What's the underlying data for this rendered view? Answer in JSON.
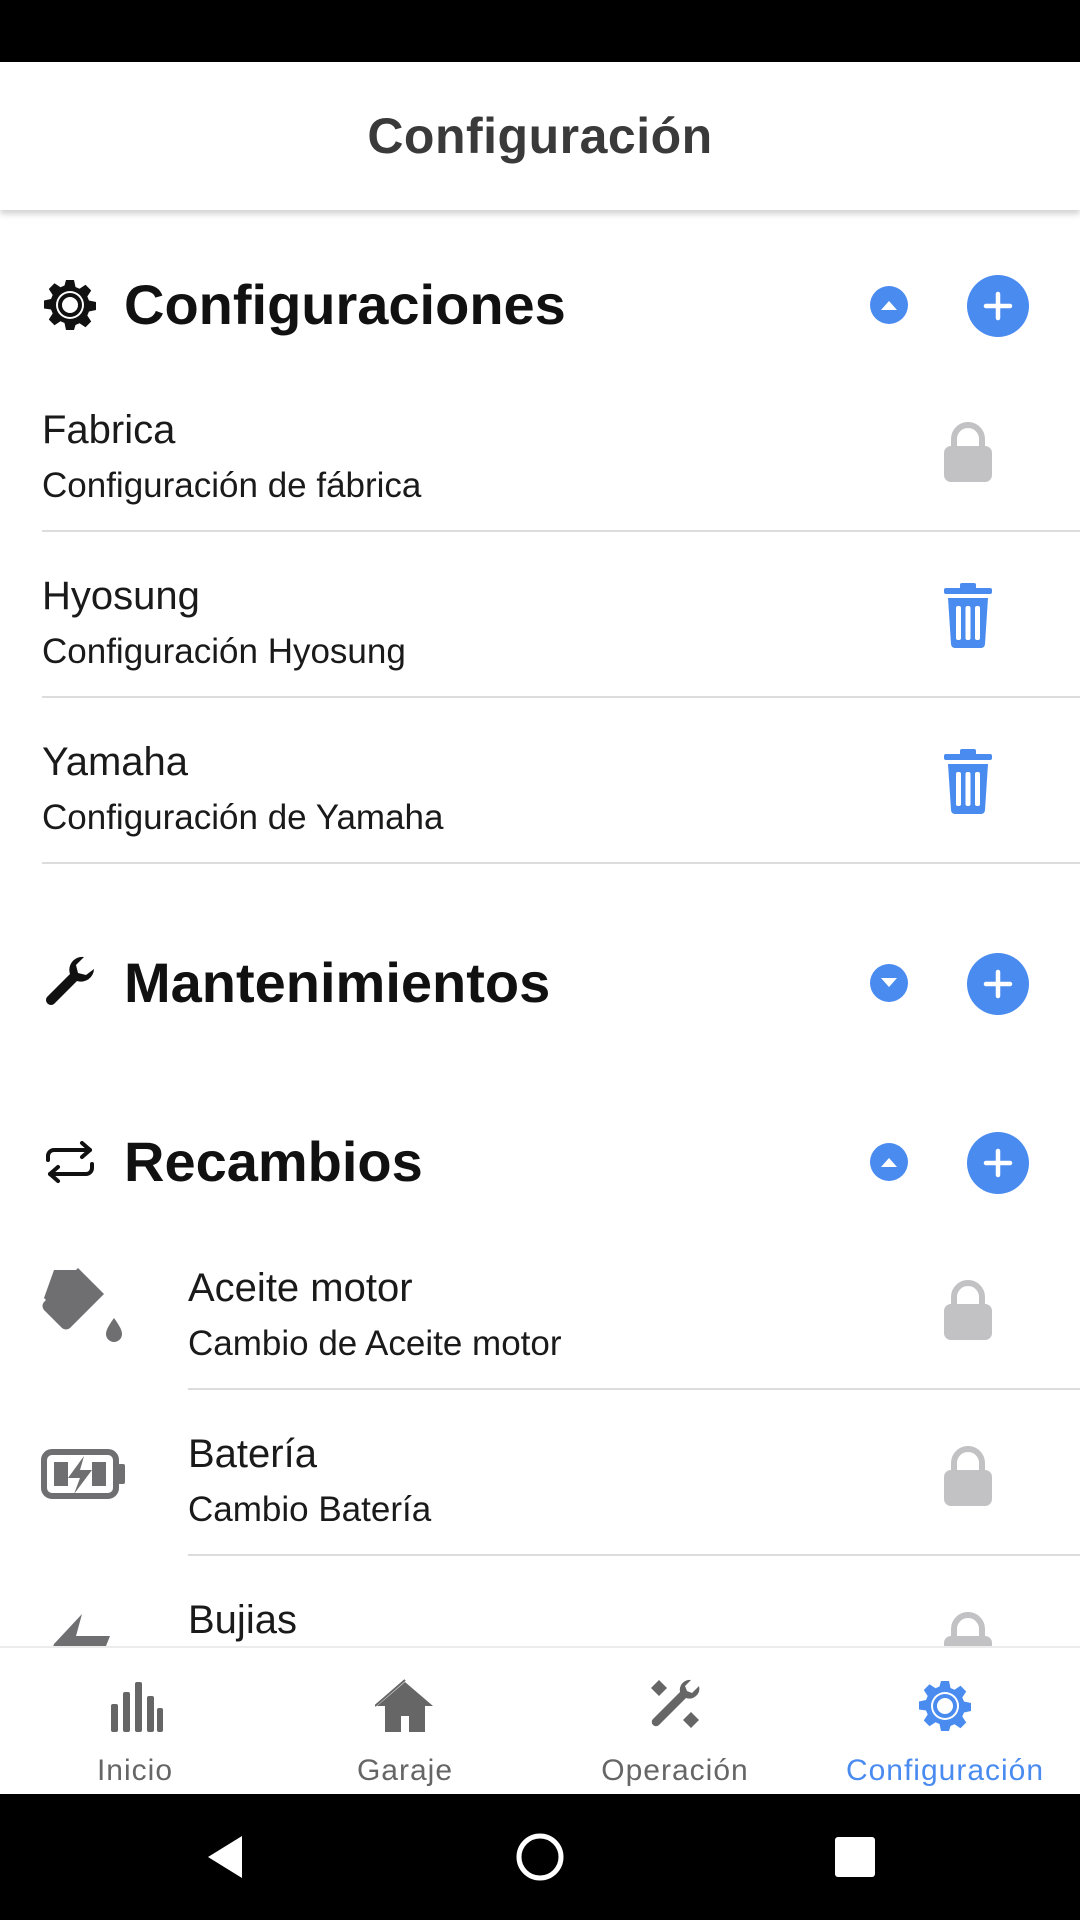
{
  "header": {
    "title": "Configuración"
  },
  "sections": {
    "configuraciones": {
      "title": "Configuraciones",
      "icon": "gear-icon",
      "expanded": true,
      "items": [
        {
          "label": "Fabrica",
          "sub": "Configuración de fábrica",
          "action_icon": "lock-icon"
        },
        {
          "label": "Hyosung",
          "sub": "Configuración Hyosung",
          "action_icon": "trash-icon"
        },
        {
          "label": "Yamaha",
          "sub": "Configuración de Yamaha",
          "action_icon": "trash-icon"
        }
      ]
    },
    "mantenimientos": {
      "title": "Mantenimientos",
      "icon": "wrench-icon",
      "expanded": false
    },
    "recambios": {
      "title": "Recambios",
      "icon": "swap-icon",
      "expanded": true,
      "items": [
        {
          "label": "Aceite motor",
          "sub": "Cambio de Aceite motor",
          "lead_icon": "oil-can-icon",
          "action_icon": "lock-icon"
        },
        {
          "label": "Batería",
          "sub": "Cambio Batería",
          "lead_icon": "battery-charging-icon",
          "action_icon": "lock-icon"
        },
        {
          "label": "Bujias",
          "sub": "",
          "lead_icon": "spark-plug-icon",
          "action_icon": "lock-icon"
        }
      ]
    }
  },
  "bottom_nav": {
    "active": "Configuración",
    "items": [
      {
        "label": "Inicio",
        "icon": "bar-chart-icon"
      },
      {
        "label": "Garaje",
        "icon": "home-icon"
      },
      {
        "label": "Operación",
        "icon": "tools-icon"
      },
      {
        "label": "Configuración",
        "icon": "gear-icon"
      }
    ]
  },
  "colors": {
    "accent": "#4a8bf0",
    "lock_gray": "#c2c2c4",
    "icon_gray": "#6f6f72",
    "divider": "#dcdcdc"
  },
  "system_nav": {
    "buttons": [
      "back-icon",
      "home-circle-icon",
      "recents-icon"
    ]
  }
}
